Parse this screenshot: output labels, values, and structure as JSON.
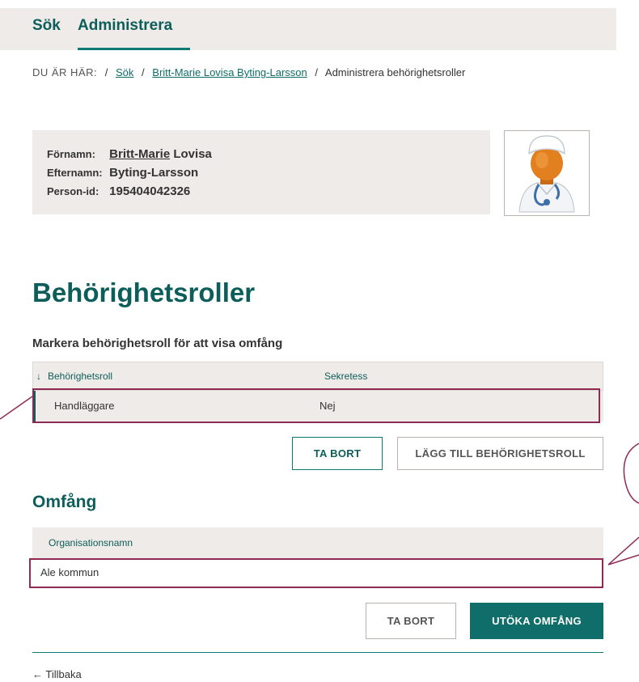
{
  "topnav": {
    "sok": "Sök",
    "administrera": "Administrera"
  },
  "breadcrumb": {
    "prefix": "DU ÄR HÄR:",
    "sep": "/",
    "sok": "Sök",
    "person": "Britt-Marie Lovisa Byting-Larsson",
    "current": "Administrera behörighetsroller"
  },
  "person": {
    "fornamn_label": "Förnamn:",
    "fornamn_part1": "Britt-",
    "fornamn_part2": "Marie",
    "fornamn_part3": " Lovisa",
    "efternamn_label": "Efternamn:",
    "efternamn": "Byting-Larsson",
    "personid_label": "Person-id:",
    "personid": "195404042326"
  },
  "page_title": "Behörighetsroller",
  "roles": {
    "instruction": "Markera behörighetsroll för att visa omfång",
    "sort_arrow": "↓",
    "col_role": "Behörighetsroll",
    "col_sekretess": "Sekretess",
    "rows": [
      {
        "role": "Handläggare",
        "sekretess": "Nej"
      }
    ],
    "remove_button": "TA BORT",
    "add_button": "LÄGG TILL BEHÖRIGHETSROLL"
  },
  "omfang": {
    "heading": "Omfång",
    "col_org": "Organisationsnamn",
    "rows": [
      {
        "org": "Ale kommun"
      }
    ],
    "remove_button": "TA BORT",
    "extend_button": "UTÖKA OMFÅNG"
  },
  "back_link": "← Tillbaka",
  "colors": {
    "brand_teal": "#0d5e5a",
    "button_teal": "#0f6e69",
    "panel_bg": "#efebe8",
    "highlight": "#8f2a57"
  }
}
